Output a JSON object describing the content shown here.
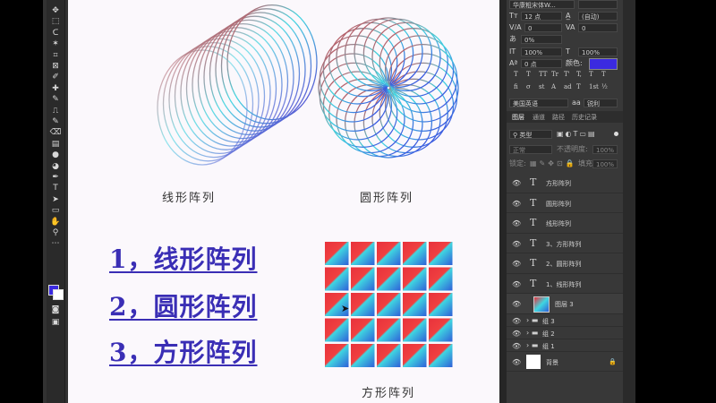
{
  "canvas": {
    "labels": {
      "line_array": "线形阵列",
      "circle_array": "圆形阵列",
      "square_array": "方形阵列"
    },
    "headings": [
      "1，线形阵列",
      "2，圆形阵列",
      "3，方形阵列"
    ],
    "grid": {
      "rows": 5,
      "cols": 5
    },
    "colors": {
      "heading": "#3a2eb5",
      "grad_red": "#e8323c",
      "grad_cyan": "#3fd6e0",
      "grad_blue": "#2f5fd8",
      "grad_purple": "#5a2fd0"
    }
  },
  "character_panel": {
    "font_family": "华康粗宋体W...",
    "font_size": "12 点",
    "leading": "(自动)",
    "kerning": "0",
    "tracking": "0",
    "scale_pct": "0%",
    "vscale": "100%",
    "hscale": "100%",
    "baseline": "0 点",
    "color_label": "颜色:",
    "color_value": "#3b2ae0",
    "type_buttons": [
      "T",
      "T",
      "TT",
      "Tr",
      "T'",
      "T,",
      "T",
      "T"
    ],
    "extra_buttons": [
      "fi",
      "σ",
      "st",
      "A",
      "ad",
      "T",
      "1st",
      "½"
    ],
    "language": "美国英语",
    "antialias": "锐利"
  },
  "layers_panel": {
    "tabs": [
      "图层",
      "通道",
      "路径",
      "历史记录"
    ],
    "filter_kind": "类型",
    "blend_mode": "正常",
    "opacity_label": "不透明度:",
    "opacity": "100%",
    "lock_label": "锁定:",
    "fill_label": "填充:",
    "fill": "100%",
    "layers": [
      {
        "type": "text",
        "name": "方形阵列"
      },
      {
        "type": "text",
        "name": "圆形阵列"
      },
      {
        "type": "text",
        "name": "线形阵列"
      },
      {
        "type": "text",
        "name": "3、方形阵列"
      },
      {
        "type": "text",
        "name": "2、圆形阵列"
      },
      {
        "type": "text",
        "name": "1、线形阵列"
      },
      {
        "type": "image",
        "name": "图层 3"
      },
      {
        "type": "group",
        "name": "组 3"
      },
      {
        "type": "group",
        "name": "组 2"
      },
      {
        "type": "group",
        "name": "组 1"
      },
      {
        "type": "background",
        "name": "背景"
      }
    ]
  },
  "toolbar": {
    "tools": [
      "move-tool",
      "marquee-tool",
      "lasso-tool",
      "magic-wand-tool",
      "crop-tool",
      "frame-tool",
      "eyedropper-tool",
      "healing-tool",
      "brush-tool",
      "stamp-tool",
      "history-brush-tool",
      "eraser-tool",
      "gradient-tool",
      "blur-tool",
      "dodge-tool",
      "pen-tool",
      "type-tool",
      "path-select-tool",
      "rectangle-tool",
      "hand-tool",
      "zoom-tool",
      "more-tool"
    ],
    "foreground_color": "#3b2ae0",
    "background_color": "#ffffff"
  }
}
